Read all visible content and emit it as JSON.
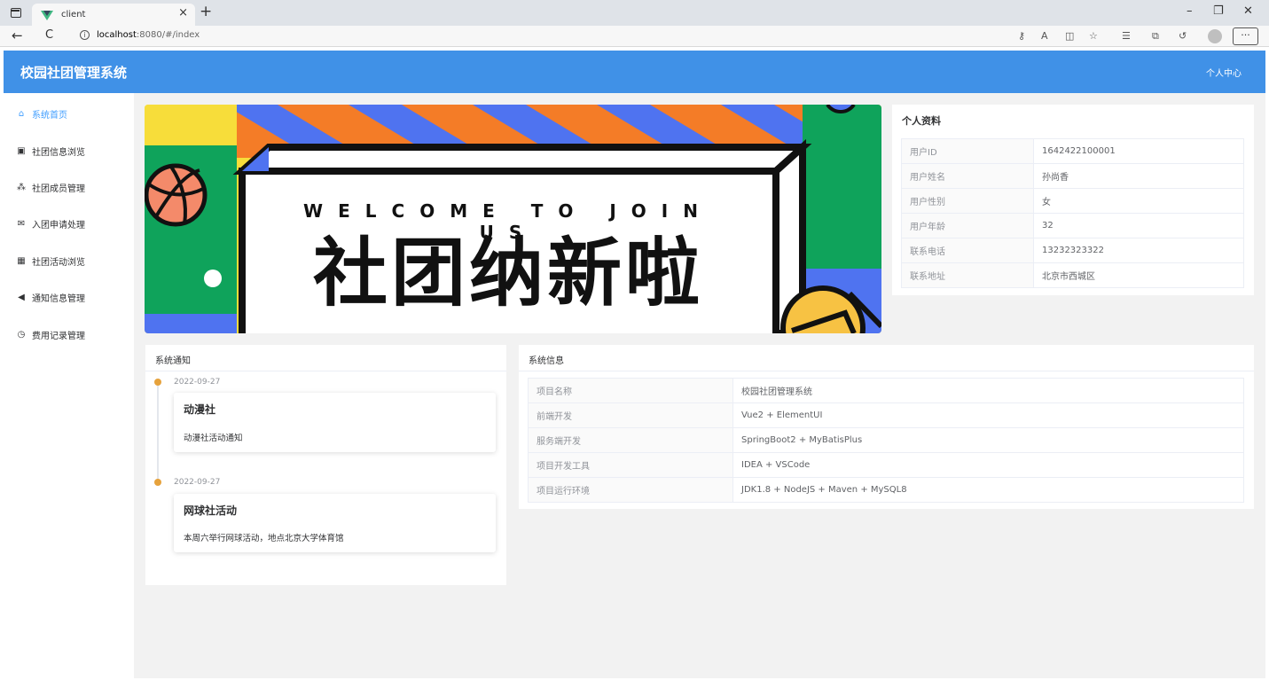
{
  "browser": {
    "tab_title": "client",
    "new_tab": "+",
    "close_tab": "×",
    "url_host": "localhost",
    "url_rest": ":8080/#/index",
    "win_min": "–",
    "win_restore": "❐",
    "win_close": "✕",
    "back": "←",
    "reload": "C",
    "more": "···"
  },
  "header": {
    "title": "校园社团管理系统",
    "user_menu": "个人中心"
  },
  "sidebar": {
    "items": [
      {
        "icon": "home-icon",
        "glyph": "⌂",
        "label": "系统首页",
        "active": true
      },
      {
        "icon": "monitor-icon",
        "glyph": "▣",
        "label": "社团信息浏览"
      },
      {
        "icon": "users-icon",
        "glyph": "⁂",
        "label": "社团成员管理"
      },
      {
        "icon": "envelope-icon",
        "glyph": "✉",
        "label": "入团申请处理"
      },
      {
        "icon": "calculator-icon",
        "glyph": "▦",
        "label": "社团活动浏览"
      },
      {
        "icon": "megaphone-icon",
        "glyph": "◀",
        "label": "通知信息管理"
      },
      {
        "icon": "clock-icon",
        "glyph": "◷",
        "label": "费用记录管理"
      }
    ]
  },
  "banner": {
    "welcome": "WELCOME TO JOIN US",
    "headline": "社团纳新啦"
  },
  "profile": {
    "title": "个人资料",
    "rows": [
      {
        "label": "用户ID",
        "value": "1642422100001"
      },
      {
        "label": "用户姓名",
        "value": "孙尚香"
      },
      {
        "label": "用户性别",
        "value": "女"
      },
      {
        "label": "用户年龄",
        "value": "32"
      },
      {
        "label": "联系电话",
        "value": "13232323322"
      },
      {
        "label": "联系地址",
        "value": "北京市西城区"
      }
    ]
  },
  "notices": {
    "title": "系统通知",
    "items": [
      {
        "date": "2022-09-27",
        "title": "动漫社",
        "content": "动漫社活动通知"
      },
      {
        "date": "2022-09-27",
        "title": "网球社活动",
        "content": "本周六举行网球活动，地点北京大学体育馆"
      }
    ]
  },
  "sysinfo": {
    "title": "系统信息",
    "rows": [
      {
        "label": "项目名称",
        "value": "校园社团管理系统"
      },
      {
        "label": "前端开发",
        "value": "Vue2 + ElementUI"
      },
      {
        "label": "服务端开发",
        "value": "SpringBoot2 + MyBatisPlus"
      },
      {
        "label": "项目开发工具",
        "value": "IDEA + VSCode"
      },
      {
        "label": "项目运行环境",
        "value": "JDK1.8 + NodeJS + Maven + MySQL8"
      }
    ]
  },
  "colors": {
    "header": "#4091e7",
    "accent": "#409eff",
    "timeline_dot": "#e6a23c"
  }
}
